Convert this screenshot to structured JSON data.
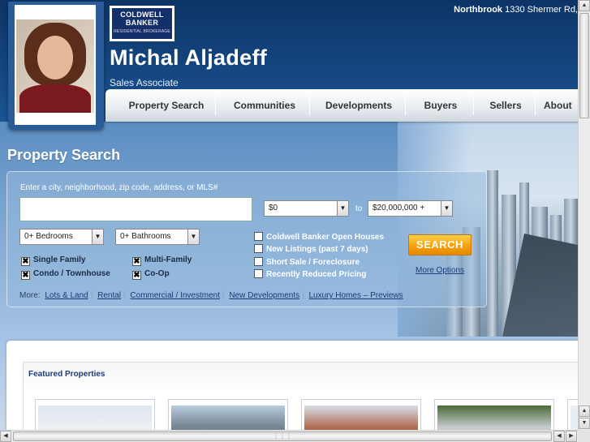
{
  "header": {
    "logo": {
      "line1": "COLDWELL",
      "line2": "BANKER",
      "line3": "RESIDENTIAL BROKERAGE"
    },
    "agent_name": "Michal Aljadeff",
    "agent_title": "Sales Associate",
    "office_city": "Northbrook",
    "office_address": "1330 Shermer Rd,"
  },
  "nav": {
    "items": [
      "Property Search",
      "Communities",
      "Developments",
      "Buyers",
      "Sellers",
      "About"
    ]
  },
  "search": {
    "title": "Property Search",
    "hint": "Enter a city, neighborhood, zip code, address, or MLS#",
    "input_value": "",
    "price_min": "$0",
    "price_to": "to",
    "price_max": "$20,000,000 +",
    "bedrooms": "0+ Bedrooms",
    "bathrooms": "0+ Bathrooms",
    "property_types": [
      {
        "label": "Single Family",
        "checked": true
      },
      {
        "label": "Multi-Family",
        "checked": true
      },
      {
        "label": "Condo / Townhouse",
        "checked": true
      },
      {
        "label": "Co-Op",
        "checked": true
      }
    ],
    "filters": [
      {
        "label": "Coldwell Banker Open Houses",
        "checked": false
      },
      {
        "label": "New Listings (past 7 days)",
        "checked": false
      },
      {
        "label": "Short Sale / Foreclosure",
        "checked": false
      },
      {
        "label": "Recently Reduced Pricing",
        "checked": false
      }
    ],
    "search_button": "SEARCH",
    "more_options": "More Options",
    "more_label": "More:",
    "more_links": [
      "Lots & Land",
      "Rental",
      "Commercial / Investment",
      "New Developments",
      "Luxury Homes – Previews"
    ]
  },
  "featured": {
    "title": "Featured Properties"
  },
  "icons": {
    "check": "✖",
    "dropdown_arrow": "▼",
    "scroll_up": "▲",
    "scroll_down": "▼",
    "scroll_left": "◀",
    "scroll_right": "▶"
  }
}
